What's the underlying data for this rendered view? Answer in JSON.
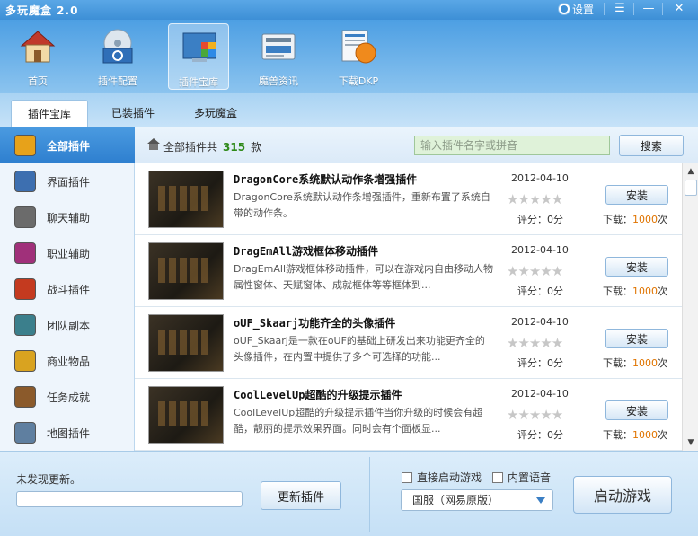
{
  "window": {
    "title": "多玩魔盒 2.0",
    "settings_label": "设置",
    "menu_glyph": "☰",
    "minimize_glyph": "—",
    "close_glyph": "✕"
  },
  "topnav": [
    {
      "label": "首页",
      "icon": "house-icon"
    },
    {
      "label": "插件配置",
      "icon": "disc-gear-icon"
    },
    {
      "label": "插件宝库",
      "icon": "plugin-grid-icon"
    },
    {
      "label": "魔兽资讯",
      "icon": "news-icon"
    },
    {
      "label": "下载DKP",
      "icon": "dkp-icon"
    }
  ],
  "tabs": [
    "插件宝库",
    "已装插件",
    "多玩魔盒"
  ],
  "sidebar": [
    {
      "label": "全部插件",
      "color": "#e7a21a"
    },
    {
      "label": "界面插件",
      "color": "#3d6fb0"
    },
    {
      "label": "聊天辅助",
      "color": "#6b6b6b"
    },
    {
      "label": "职业辅助",
      "color": "#a0307a"
    },
    {
      "label": "战斗插件",
      "color": "#c43a1f"
    },
    {
      "label": "团队副本",
      "color": "#3b7f8c"
    },
    {
      "label": "商业物品",
      "color": "#d9a320"
    },
    {
      "label": "任务成就",
      "color": "#8b5a2b"
    },
    {
      "label": "地图插件",
      "color": "#5f7fa0"
    }
  ],
  "list_header": {
    "prefix": "全部插件共",
    "count": "315",
    "suffix": "款",
    "search_placeholder": "输入插件名字或拼音",
    "search_button": "搜索"
  },
  "plugins": [
    {
      "name": "DragonCore系统默认动作条增强插件",
      "desc": "DragonCore系统默认动作条增强插件，重新布置了系统自带的动作条。",
      "date": "2012-04-10",
      "stars": "★★★★★",
      "score_label": "评分：",
      "score": "0分",
      "install": "安装",
      "downloads_label": "下载：",
      "downloads": "1000",
      "downloads_unit": "次"
    },
    {
      "name": "DragEmAll游戏框体移动插件",
      "desc": "DragEmAll游戏框体移动插件，可以在游戏内自由移动人物属性窗体、天赋窗体、成就框体等等框体到...",
      "date": "2012-04-10",
      "stars": "★★★★★",
      "score_label": "评分：",
      "score": "0分",
      "install": "安装",
      "downloads_label": "下载：",
      "downloads": "1000",
      "downloads_unit": "次"
    },
    {
      "name": "oUF_Skaarj功能齐全的头像插件",
      "desc": "oUF_Skaarj是一款在oUF的基础上研发出来功能更齐全的头像插件，在内置中提供了多个可选择的功能...",
      "date": "2012-04-10",
      "stars": "★★★★★",
      "score_label": "评分：",
      "score": "0分",
      "install": "安装",
      "downloads_label": "下载：",
      "downloads": "1000",
      "downloads_unit": "次"
    },
    {
      "name": "CoolLevelUp超酷的升级提示插件",
      "desc": "CoolLevelUp超酷的升级提示插件当你升级的时候会有超酷，靓丽的提示效果界面。同时会有个面板显...",
      "date": "2012-04-10",
      "stars": "★★★★★",
      "score_label": "评分：",
      "score": "0分",
      "install": "安装",
      "downloads_label": "下载：",
      "downloads": "1000",
      "downloads_unit": "次"
    }
  ],
  "bottom": {
    "status": "未发现更新。",
    "update_button": "更新插件",
    "direct_start": "直接启动游戏",
    "builtin_voice": "内置语音",
    "server": "国服（网易原版）",
    "start_button": "启动游戏"
  }
}
